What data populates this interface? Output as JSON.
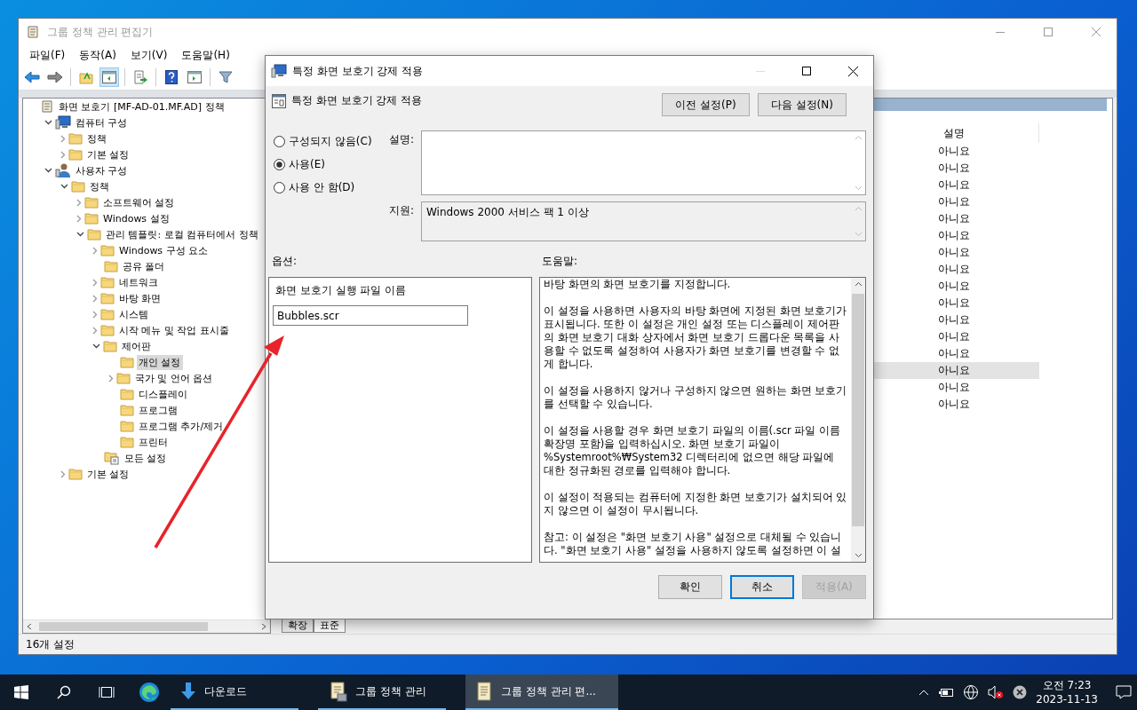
{
  "main_window": {
    "title": "그룹 정책 관리 편집기",
    "menu": [
      "파일(F)",
      "동작(A)",
      "보기(V)",
      "도움말(H)"
    ],
    "tree": {
      "label": "화면 보호기 [MF-AD-01.MF.AD] 정책",
      "kind": "policy",
      "selected": false,
      "children": [
        {
          "label": "컴퓨터 구성",
          "kind": "computer",
          "expanded": true,
          "selected": false,
          "children": [
            {
              "label": "정책",
              "kind": "folder",
              "expanded": false,
              "selected": false
            },
            {
              "label": "기본 설정",
              "kind": "folder",
              "expanded": false,
              "selected": false
            }
          ]
        },
        {
          "label": "사용자 구성",
          "kind": "user",
          "expanded": true,
          "selected": false,
          "children": [
            {
              "label": "정책",
              "kind": "folder",
              "expanded": true,
              "selected": false,
              "children": [
                {
                  "label": "소프트웨어 설정",
                  "kind": "folder",
                  "expanded": false,
                  "selected": false
                },
                {
                  "label": "Windows 설정",
                  "kind": "folder",
                  "expanded": false,
                  "selected": false
                },
                {
                  "label": "관리 템플릿: 로컬 컴퓨터에서 정책",
                  "kind": "folder",
                  "expanded": true,
                  "selected": false,
                  "children": [
                    {
                      "label": "Windows 구성 요소",
                      "kind": "folder",
                      "expanded": false,
                      "selected": false
                    },
                    {
                      "label": "공유 폴더",
                      "kind": "folder",
                      "selected": false
                    },
                    {
                      "label": "네트워크",
                      "kind": "folder",
                      "expanded": false,
                      "selected": false
                    },
                    {
                      "label": "바탕 화면",
                      "kind": "folder",
                      "expanded": false,
                      "selected": false
                    },
                    {
                      "label": "시스템",
                      "kind": "folder",
                      "expanded": false,
                      "selected": false
                    },
                    {
                      "label": "시작 메뉴 및 작업 표시줄",
                      "kind": "folder",
                      "expanded": false,
                      "selected": false
                    },
                    {
                      "label": "제어판",
                      "kind": "folder",
                      "expanded": true,
                      "selected": false,
                      "children": [
                        {
                          "label": "개인 설정",
                          "kind": "folder",
                          "selected": true
                        },
                        {
                          "label": "국가 및 언어 옵션",
                          "kind": "folder",
                          "expanded": false,
                          "selected": false
                        },
                        {
                          "label": "디스플레이",
                          "kind": "folder",
                          "selected": false
                        },
                        {
                          "label": "프로그램",
                          "kind": "folder",
                          "selected": false
                        },
                        {
                          "label": "프로그램 추가/제거",
                          "kind": "folder",
                          "selected": false
                        },
                        {
                          "label": "프린터",
                          "kind": "folder",
                          "selected": false
                        }
                      ]
                    },
                    {
                      "label": "모든 설정",
                      "kind": "settings",
                      "selected": false
                    }
                  ]
                }
              ]
            },
            {
              "label": "기본 설정",
              "kind": "folder",
              "expanded": false,
              "selected": false
            }
          ]
        }
      ]
    },
    "list": {
      "columns": [
        "설명"
      ],
      "rows": [
        {
          "cells": [
            "아니요"
          ],
          "selected": false
        },
        {
          "cells": [
            "아니요"
          ],
          "selected": false
        },
        {
          "cells": [
            "아니요"
          ],
          "selected": false
        },
        {
          "cells": [
            "아니요"
          ],
          "selected": false
        },
        {
          "cells": [
            "아니요"
          ],
          "selected": false
        },
        {
          "cells": [
            "아니요"
          ],
          "selected": false
        },
        {
          "cells": [
            "아니요"
          ],
          "selected": false
        },
        {
          "cells": [
            "아니요"
          ],
          "selected": false
        },
        {
          "cells": [
            "아니요"
          ],
          "selected": false
        },
        {
          "cells": [
            "아니요"
          ],
          "selected": false
        },
        {
          "cells": [
            "아니요"
          ],
          "selected": false
        },
        {
          "cells": [
            "아니요"
          ],
          "selected": false
        },
        {
          "cells": [
            "아니요"
          ],
          "selected": false
        },
        {
          "cells": [
            "아니요"
          ],
          "selected": true
        },
        {
          "cells": [
            "아니요"
          ],
          "selected": false
        },
        {
          "cells": [
            "아니요"
          ],
          "selected": false
        }
      ]
    },
    "tabs": [
      {
        "label": "확장",
        "selected": false
      },
      {
        "label": "표준",
        "selected": true
      }
    ],
    "status_bar": "16개 설정"
  },
  "dialog": {
    "title": "특정 화면 보호기 강제 적용",
    "heading": "특정 화면 보호기 강제 적용",
    "nav_buttons": [
      "이전 설정(P)",
      "다음 설정(N)"
    ],
    "states": [
      {
        "label": "구성되지 않음(C)",
        "selected": false
      },
      {
        "label": "사용(E)",
        "selected": true
      },
      {
        "label": "사용 안 함(D)",
        "selected": false
      }
    ],
    "comment_label": "설명:",
    "supported_label": "지원:",
    "supported": "Windows 2000 서비스 팩 1 이상",
    "options_label": "옵션:",
    "help_label": "도움말:",
    "options": {
      "field_label": "화면 보호기 실행 파일 이름",
      "value": "Bubbles.scr"
    },
    "help": [
      "바탕 화면의 화면 보호기를 지정합니다.",
      "이 설정을 사용하면 사용자의 바탕 화면에 지정된 화면 보호기가 표시됩니다. 또한 이 설정은 개인 설정 또는 디스플레이 제어판의 화면 보호기 대화 상자에서 화면 보호기 드롭다운 목록을 사용할 수 없도록 설정하여 사용자가 화면 보호기를 변경할 수 없게 합니다.",
      "이 설정을 사용하지 않거나 구성하지 않으면 원하는 화면 보호기를 선택할 수 있습니다.",
      "이 설정을 사용할 경우 화면 보호기 파일의 이름(.scr 파일 이름 확장명 포함)을 입력하십시오. 화면 보호기 파일이 %Systemroot%₩System32 디렉터리에 없으면 해당 파일에 대한 정규화된 경로를 입력해야 합니다.",
      "이 설정이 적용되는 컴퓨터에 지정한 화면 보호기가 설치되어 있지 않으면 이 설정이 무시됩니다.",
      "참고: 이 설정은 \"화면 보호기 사용\" 설정으로 대체될 수 있습니다.  \"화면 보호기 사용\" 설정을 사용하지 않도록 설정하면 이 설"
    ],
    "buttons": [
      {
        "label": "확인",
        "focused": false,
        "disabled": false
      },
      {
        "label": "취소",
        "focused": true,
        "disabled": false
      },
      {
        "label": "적용(A)",
        "focused": false,
        "disabled": true
      }
    ]
  },
  "taskbar": {
    "items": [
      {
        "label": "다운로드",
        "kind": "download",
        "active": false
      },
      {
        "label": "그룹 정책 관리",
        "kind": "gpo",
        "active": false
      },
      {
        "label": "그룹 정책 관리 편...",
        "kind": "notepad",
        "active": true
      }
    ],
    "time": "오전 7:23",
    "date": "2023-11-13"
  }
}
